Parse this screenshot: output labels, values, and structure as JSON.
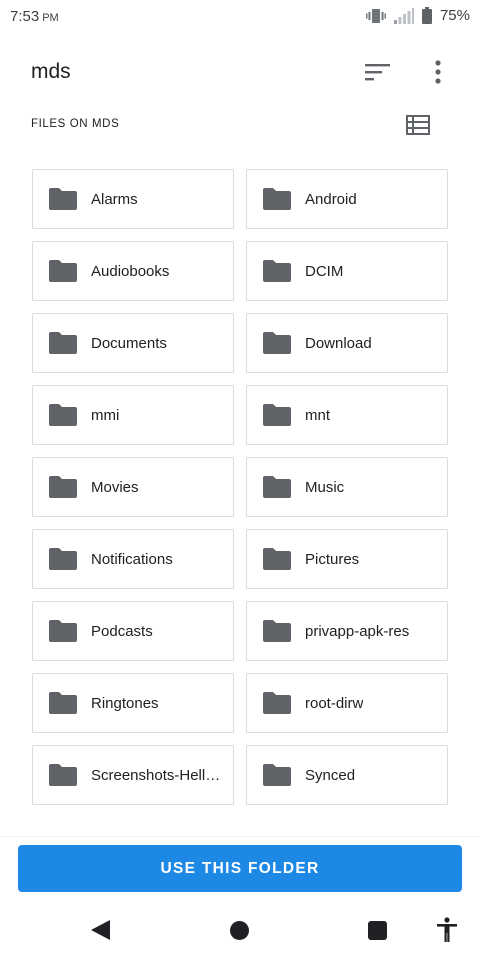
{
  "status_bar": {
    "time": "7:53",
    "ampm": "PM",
    "battery_percent": "75%",
    "icons": [
      "vibrate-icon",
      "signal-icon",
      "battery-icon"
    ]
  },
  "app_bar": {
    "title": "mds",
    "icons": [
      "sort-icon",
      "more-vert-icon"
    ]
  },
  "section": {
    "label": "FILES ON MDS",
    "view_toggle_icon": "list-view-icon"
  },
  "folders": [
    "Alarms",
    "Android",
    "Audiobooks",
    "DCIM",
    "Documents",
    "Download",
    "mmi",
    "mnt",
    "Movies",
    "Music",
    "Notifications",
    "Pictures",
    "Podcasts",
    "privapp-apk-res",
    "Ringtones",
    "root-dirw",
    "Screenshots-Hell…",
    "Synced"
  ],
  "action": {
    "use_folder_label": "USE THIS FOLDER"
  },
  "colors": {
    "accent": "#1e88e5",
    "folder_icon": "#606368",
    "card_border": "#dadce0"
  }
}
